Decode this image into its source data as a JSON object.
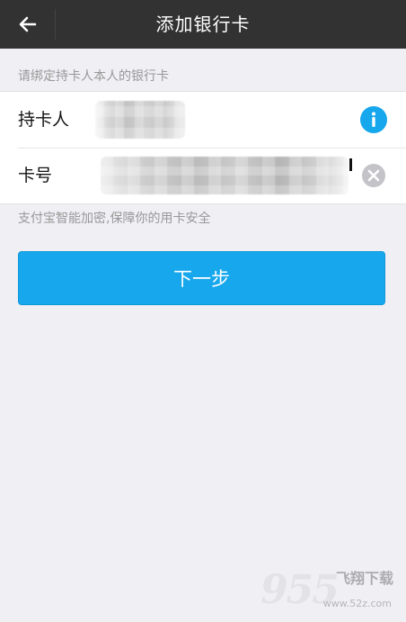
{
  "header": {
    "title": "添加银行卡",
    "back_icon": "arrow-left-icon"
  },
  "hint": "请绑定持卡人本人的银行卡",
  "form": {
    "cardholder": {
      "label": "持卡人",
      "info_icon": "info-icon"
    },
    "card_number": {
      "label": "卡号",
      "clear_icon": "clear-icon"
    }
  },
  "secure_note": "支付宝智能加密,保障你的用卡安全",
  "next_button": "下一步",
  "colors": {
    "header_bg": "#323232",
    "accent": "#16a7ec",
    "page_bg": "#efeff4"
  },
  "watermark": {
    "digits": "955",
    "brand": "飞翔下载",
    "url": "www.52z.com"
  }
}
